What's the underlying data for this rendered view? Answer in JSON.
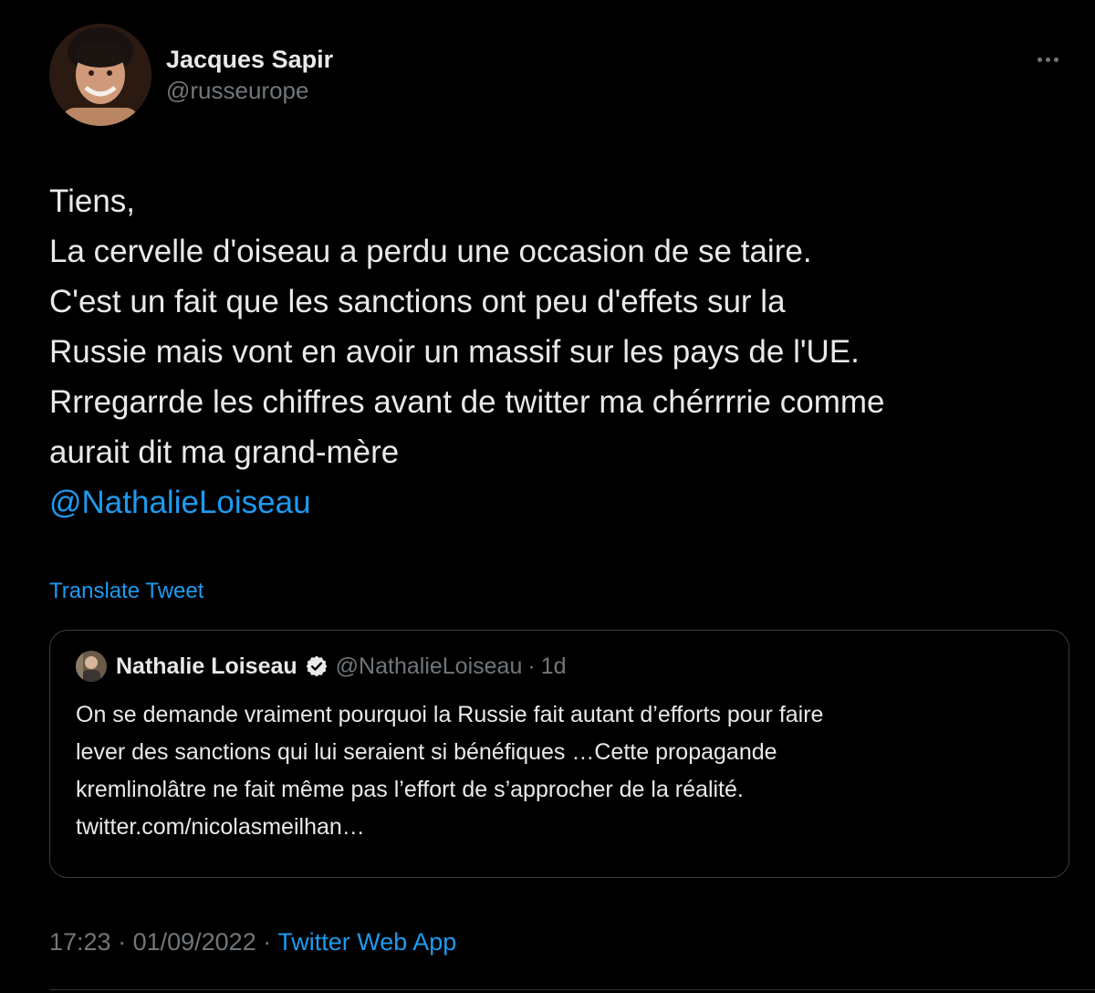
{
  "author": {
    "display_name": "Jacques Sapir",
    "handle": "@russeurope",
    "avatar": "portrait-avatar"
  },
  "tweet": {
    "lines": [
      "Tiens,",
      "La cervelle d'oiseau a perdu une occasion de se taire.",
      "C'est un fait que les sanctions ont peu d'effets sur la",
      "Russie mais vont en avoir un massif sur les pays de l'UE.",
      "Rrregarrde les chiffres avant de twitter ma chérrrrie comme",
      "aurait dit ma grand-mère"
    ],
    "mention": "@NathalieLoiseau",
    "translate_label": "Translate Tweet"
  },
  "quoted_tweet": {
    "display_name": "Nathalie Loiseau",
    "handle": "@NathalieLoiseau",
    "separator": "·",
    "time": "1d",
    "verified_icon": "verified-badge-icon",
    "lines": [
      "On se demande vraiment pourquoi la Russie fait autant d’efforts pour faire",
      "lever des sanctions qui lui seraient si bénéfiques …Cette propagande",
      "kremlinolâtre ne fait même pas l’effort de s’approcher de la réalité.",
      "twitter.com/nicolasmeilhan…"
    ]
  },
  "meta": {
    "time": "17:23",
    "separator": " · ",
    "date": "01/09/2022",
    "source": "Twitter Web App"
  },
  "colors": {
    "background": "#000000",
    "text": "#e7e9ea",
    "secondary": "#71767b",
    "accent": "#1d9bf0",
    "border": "#3a3d40"
  },
  "icons": {
    "more": "more-dots-icon"
  }
}
